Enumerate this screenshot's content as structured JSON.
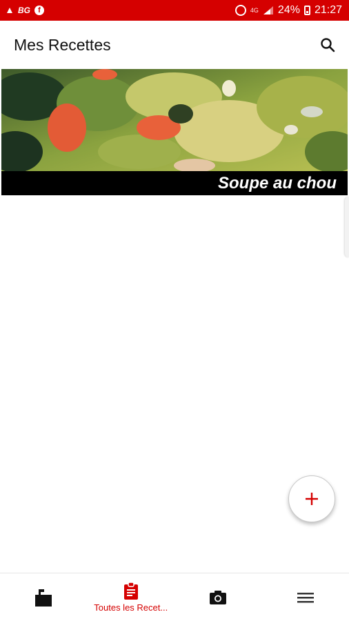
{
  "status_bar": {
    "left_text": "BG",
    "fb_letter": "f",
    "network": "4G",
    "battery": "24%",
    "time": "21:27"
  },
  "app_bar": {
    "title": "Mes Recettes",
    "search_icon": "search-icon"
  },
  "recipes": [
    {
      "title": "Soupe au chou"
    }
  ],
  "fab": {
    "icon": "plus-icon"
  },
  "bottom_nav": {
    "items": [
      {
        "icon": "mailbox-icon",
        "label": ""
      },
      {
        "icon": "clipboard-icon",
        "label": "Toutes les Recet..."
      },
      {
        "icon": "camera-icon",
        "label": ""
      },
      {
        "icon": "menu-icon",
        "label": ""
      }
    ]
  },
  "colors": {
    "accent": "#d50000",
    "caption_bg": "#000000"
  }
}
